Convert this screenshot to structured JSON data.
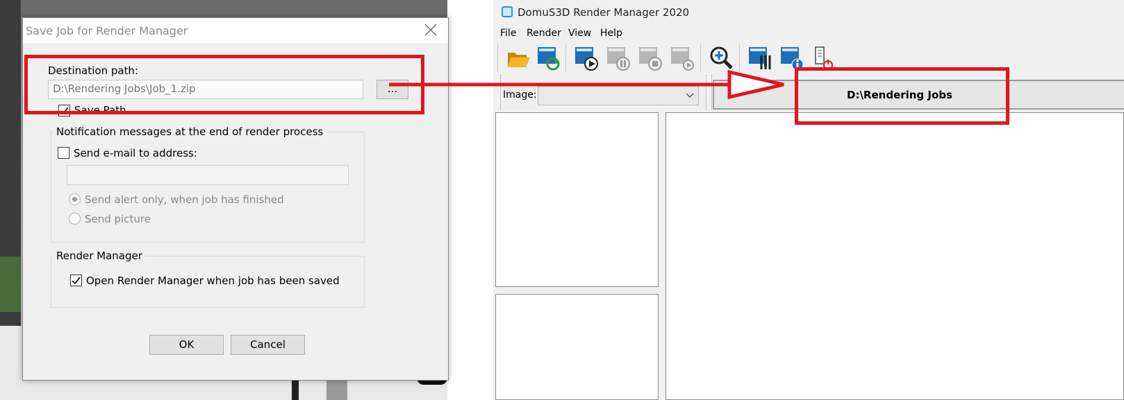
{
  "dialog": {
    "title": "Save Job for Render Manager",
    "destination_label": "Destination path:",
    "destination_value": "D:\\Rendering Jobs\\Job_1.zip",
    "browse_label": "...",
    "save_path_label": "Save Path",
    "notification_group_title": "Notification messages at the end of render process",
    "send_email_label": "Send e-mail to address:",
    "email_value": "",
    "alert_only_label": "Send alert only, when job has finished",
    "send_picture_label": "Send picture",
    "render_manager_group_title": "Render Manager",
    "open_rm_label": "Open Render Manager when job has been saved",
    "ok_label": "OK",
    "cancel_label": "Cancel"
  },
  "render_manager": {
    "title": "DomuS3D Render Manager 2020",
    "menu": [
      "File",
      "Render",
      "View",
      "Help"
    ],
    "image_label": "Image:",
    "image_value": "",
    "path_label": "D:\\Rendering Jobs",
    "toolbar_icons": [
      "folder-open-icon",
      "refresh-jobs-icon",
      "start-render-icon",
      "pause-render-icon",
      "stop-render-icon",
      "render-next-icon",
      "zoom-in-icon",
      "settings-icon",
      "info-icon",
      "shutdown-icon"
    ]
  },
  "colors": {
    "annotation_red": "#e4141e",
    "dialog_bg": "#f0f0f0",
    "accent_blue": "#1e6fb8"
  }
}
